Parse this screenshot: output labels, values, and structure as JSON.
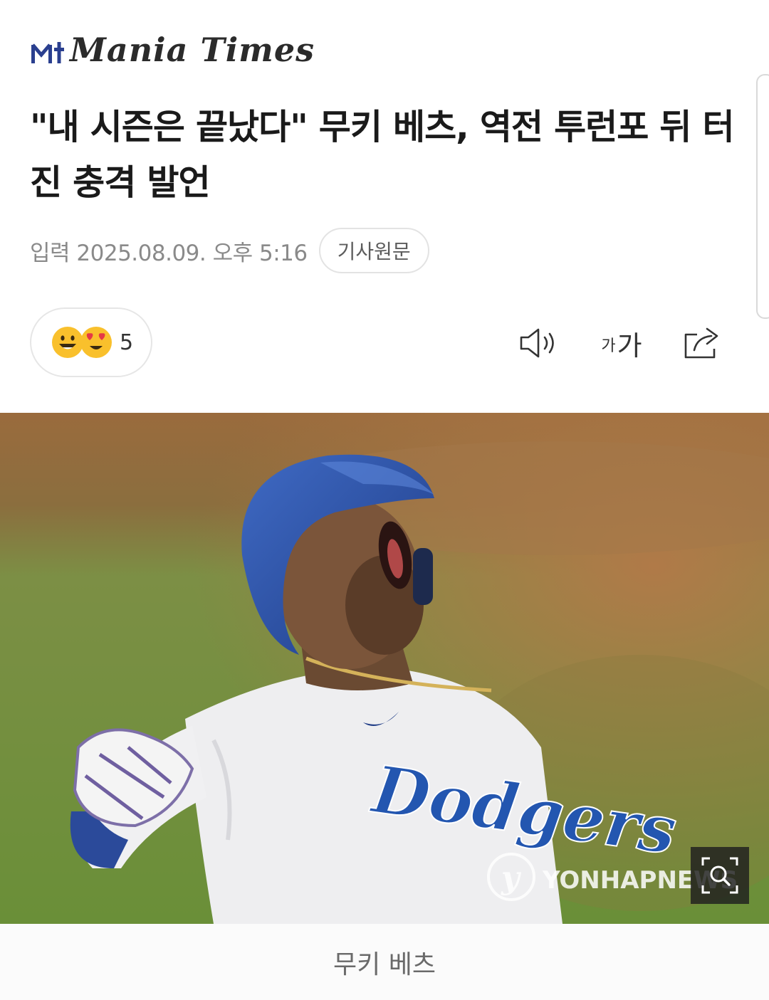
{
  "header": {
    "logo_text": "Mania Times"
  },
  "article": {
    "headline": "\"내 시즌은 끝났다\" 무키 베츠, 역전 투런포 뒤 터진 충격 발언",
    "published": "입력 2025.08.09. 오후 5:16",
    "source_button": "기사원문"
  },
  "reactions": {
    "emojis": [
      "smiling-face",
      "heart-eyes-face"
    ],
    "count": "5"
  },
  "toolbar": {
    "listen_icon": "speaker-icon",
    "font_small": "가",
    "font_large": "가",
    "share_icon": "share-icon"
  },
  "photo": {
    "watermark": "YONHAPNEWS",
    "jersey_text": "Dodgers",
    "caption": "무키 베츠"
  },
  "colors": {
    "brand_blue": "#2a3f8f",
    "headline": "#1a1a1a",
    "meta": "#8a8a8a"
  }
}
